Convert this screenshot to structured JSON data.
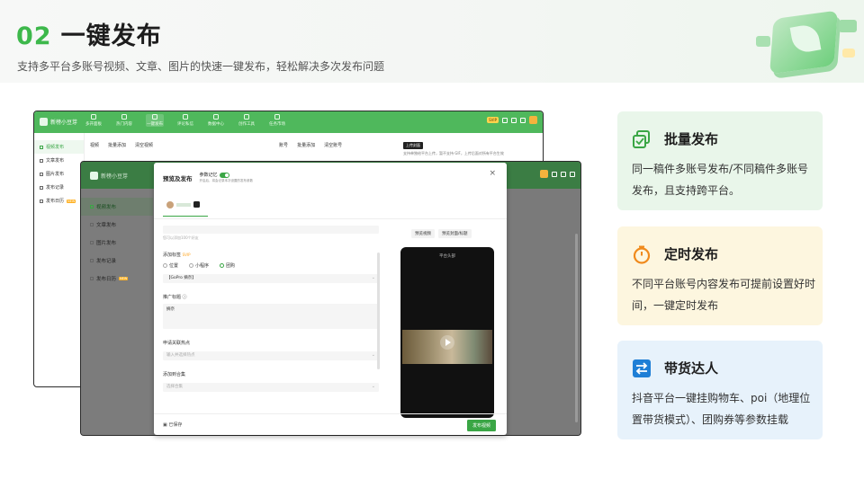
{
  "header": {
    "number": "02",
    "title": "一键发布",
    "subtitle": "支持多平台多账号视频、文章、图片的快速一键发布，轻松解决多次发布问题"
  },
  "app": {
    "brand": "新榜小豆芽",
    "nav": [
      "多开面板",
      "热门内容",
      "一键发布",
      "评论私信",
      "数据中心",
      "创作工具",
      "任务市场"
    ],
    "svip": "SVIP",
    "sidebar": [
      "视频发布",
      "文章发布",
      "图片发布",
      "发布记录",
      "发布日历"
    ],
    "sidebar_new_tag": "NEW",
    "content": {
      "video_label": "视频",
      "batch_add": "批量添加",
      "clear_video": "清空视频",
      "account_label": "账号",
      "batch_add_account": "批量添加",
      "clear_account": "清空账号",
      "upload_cover": "上传封面",
      "cover_tip": "支持单独给平台上传，暂不支持 GIF，上传后面对所有平台生效"
    }
  },
  "modal": {
    "title": "预览及发布",
    "memory_label": "参数记忆",
    "memory_sub": "开启后，将会记录本次设置的发布参数",
    "hint_topics": "您可以添加100个好友",
    "location_label": "添加标签",
    "location_vip": "SVIP",
    "radio_options": [
      "位置",
      "小程序",
      "团购"
    ],
    "radio_selected": "团购",
    "group_value": "【GoPro 摘奈】",
    "promo_label": "推广标题",
    "promo_value": "摘奈",
    "hotspot_label": "申请关联热点",
    "hotspot_placeholder": "输入并选择热点",
    "collection_label": "添加到合集",
    "collection_placeholder": "选择合集",
    "preview_video_btn": "预览视频",
    "preview_cover_btn": "预览封面/标题",
    "phone_title": "平台头部",
    "saved": "已保存",
    "publish": "发布视频"
  },
  "cards": [
    {
      "title": "批量发布",
      "body": "同一稿件多账号发布/不同稿件多账号发布，且支持跨平台。",
      "icon": "copy-icon"
    },
    {
      "title": "定时发布",
      "body": "不同平台账号内容发布可提前设置好时间，一键定时发布",
      "icon": "stopwatch-icon"
    },
    {
      "title": "带货达人",
      "body": "抖音平台一键挂购物车、poi（地理位置带货模式）、团购券等参数挂载",
      "icon": "exchange-icon"
    }
  ],
  "colors": {
    "accent": "#3db84b",
    "card1": "#e9f6ea",
    "card2": "#fdf6df",
    "card3": "#e7f2fb"
  }
}
